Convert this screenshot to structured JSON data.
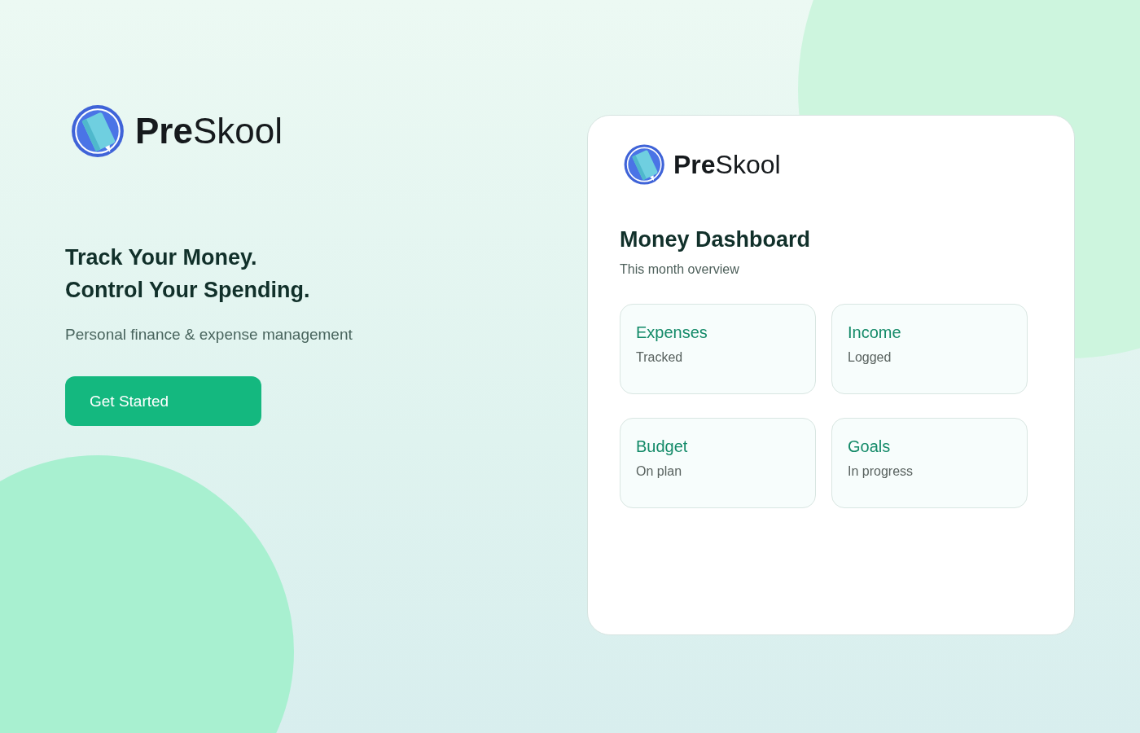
{
  "hero": {
    "logo_text": "**Pre**Skool",
    "headline": [
      "Track Your Money.",
      "Control Your Spending."
    ],
    "tagline": "Personal finance & expense management",
    "button": "Get Started"
  },
  "card": {
    "logo_text": "**Pre**Skool",
    "title": "Money Dashboard",
    "subtitle": "This month overview",
    "tiles": [
      {
        "title": "Expenses",
        "status": "Tracked"
      },
      {
        "title": "Income",
        "status": "Logged"
      },
      {
        "title": "Budget",
        "status": "On plan"
      },
      {
        "title": "Goals",
        "status": "In progress"
      }
    ]
  }
}
